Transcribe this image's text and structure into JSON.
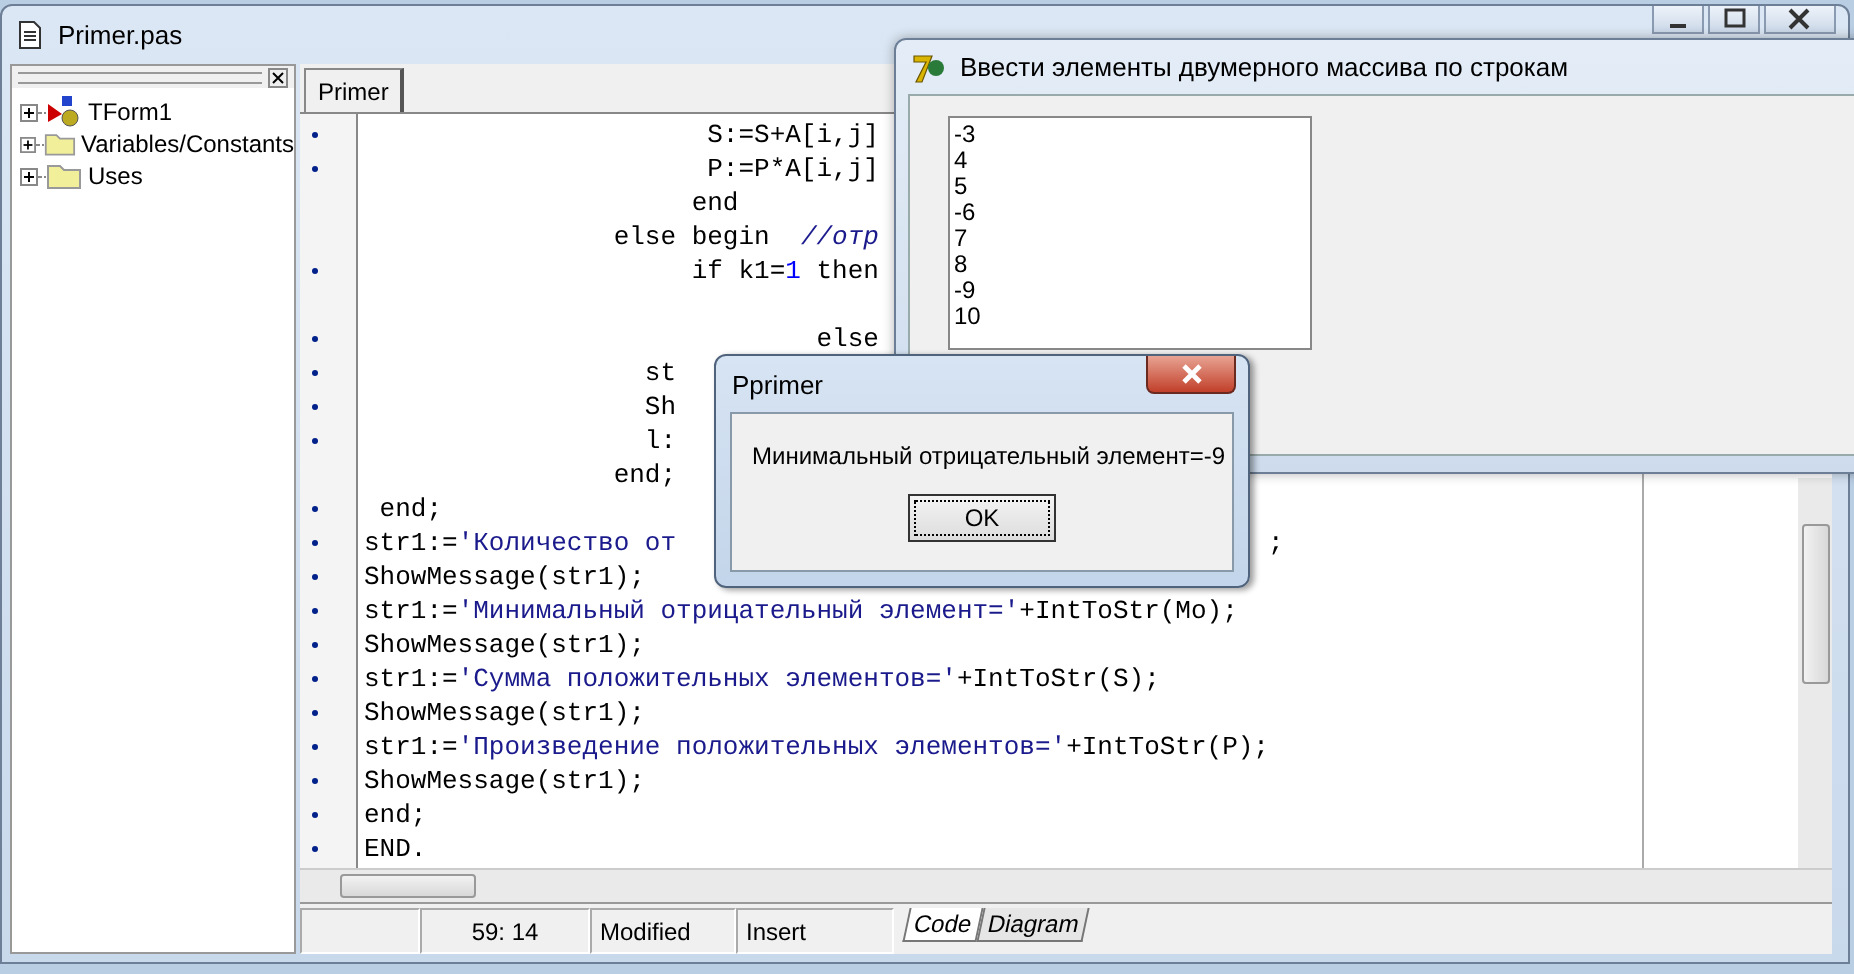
{
  "editor": {
    "title": "Primer.pas",
    "tabs": [
      {
        "label": "Primer",
        "selected": true
      }
    ],
    "lines": [
      {
        "dot": true,
        "parts": [
          {
            "kind": "plain",
            "text": "                      S:=S+A[i,j]"
          }
        ]
      },
      {
        "dot": true,
        "parts": [
          {
            "kind": "plain",
            "text": "                      P:=P*A[i,j]"
          }
        ]
      },
      {
        "dot": false,
        "parts": [
          {
            "kind": "plain",
            "text": "                     end"
          }
        ]
      },
      {
        "dot": false,
        "parts": [
          {
            "kind": "plain",
            "text": "                else begin  "
          },
          {
            "kind": "comment",
            "text": "//отр"
          }
        ]
      },
      {
        "dot": true,
        "parts": [
          {
            "kind": "plain",
            "text": "                     if k1="
          },
          {
            "kind": "number",
            "text": "1"
          },
          {
            "kind": "plain",
            "text": " then"
          }
        ]
      },
      {
        "dot": false
      },
      {
        "dot": true,
        "parts": [
          {
            "kind": "plain",
            "text": "                             else"
          }
        ]
      },
      {
        "dot": true,
        "parts": [
          {
            "kind": "plain",
            "text": "                  st"
          }
        ]
      },
      {
        "dot": true,
        "parts": [
          {
            "kind": "plain",
            "text": "                  Sh"
          }
        ]
      },
      {
        "dot": true,
        "parts": [
          {
            "kind": "plain",
            "text": "                  l:"
          }
        ]
      },
      {
        "dot": false,
        "parts": [
          {
            "kind": "plain",
            "text": "                end;"
          }
        ]
      },
      {
        "dot": true,
        "parts": [
          {
            "kind": "plain",
            "text": " end;"
          }
        ]
      },
      {
        "dot": true,
        "parts": [
          {
            "kind": "plain",
            "text": "str1:="
          },
          {
            "kind": "string",
            "text": "'Количество от"
          }
        ],
        "tail": ";"
      },
      {
        "dot": true,
        "parts": [
          {
            "kind": "plain",
            "text": "ShowMessage(str1);"
          }
        ]
      },
      {
        "dot": true,
        "parts": [
          {
            "kind": "plain",
            "text": "str1:="
          },
          {
            "kind": "string",
            "text": "'Минимальный отрицательный элемент='"
          },
          {
            "kind": "plain",
            "text": "+IntToStr(Mo);"
          }
        ]
      },
      {
        "dot": true,
        "parts": [
          {
            "kind": "plain",
            "text": "ShowMessage(str1);"
          }
        ]
      },
      {
        "dot": true,
        "parts": [
          {
            "kind": "plain",
            "text": "str1:="
          },
          {
            "kind": "string",
            "text": "'Сумма положительных элементов='"
          },
          {
            "kind": "plain",
            "text": "+IntToStr(S);"
          }
        ]
      },
      {
        "dot": true,
        "parts": [
          {
            "kind": "plain",
            "text": "ShowMessage(str1);"
          }
        ]
      },
      {
        "dot": true,
        "parts": [
          {
            "kind": "plain",
            "text": "str1:="
          },
          {
            "kind": "string",
            "text": "'Произведение положительных элементов='"
          },
          {
            "kind": "plain",
            "text": "+IntToStr(P);"
          }
        ]
      },
      {
        "dot": true,
        "parts": [
          {
            "kind": "plain",
            "text": "ShowMessage(str1);"
          }
        ]
      },
      {
        "dot": true,
        "parts": [
          {
            "kind": "plain",
            "text": "end;"
          }
        ]
      },
      {
        "dot": true,
        "parts": [
          {
            "kind": "plain",
            "text": "END."
          }
        ]
      }
    ]
  },
  "explorer": {
    "items": [
      {
        "label": "TForm1",
        "kind": "form",
        "expanded": false
      },
      {
        "label": "Variables/Constants",
        "kind": "folder",
        "expanded": false
      },
      {
        "label": "Uses",
        "kind": "folder",
        "expanded": false
      }
    ]
  },
  "status": {
    "cells": [
      "59: 14",
      "Modified",
      "Insert"
    ],
    "view_tabs": [
      {
        "label": "Code",
        "selected": true
      },
      {
        "label": "Diagram",
        "selected": false
      }
    ]
  },
  "form": {
    "title": "Ввести элементы двумерного массива по строкам",
    "memo_lines": [
      "-3",
      "4",
      "5",
      "-6",
      "7",
      "8",
      "-9",
      "10"
    ]
  },
  "dialog": {
    "title": "Pprimer",
    "message": "Минимальный отрицательный элемент=-9",
    "button": "OK"
  }
}
